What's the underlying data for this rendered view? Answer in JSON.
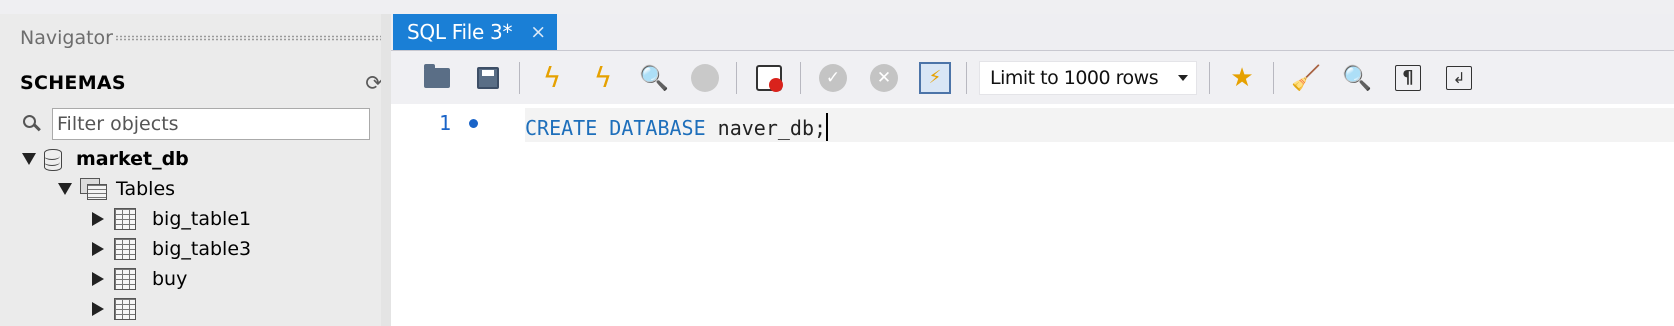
{
  "navigator": {
    "title": "Navigator",
    "schemas_label": "SCHEMAS",
    "filter_placeholder": "Filter objects",
    "tree": {
      "schema": "market_db",
      "folder": "Tables",
      "tables": [
        "big_table1",
        "big_table3",
        "buy"
      ]
    }
  },
  "editor": {
    "tab_label": "SQL File 3*",
    "tab_close": "×",
    "limit_label": "Limit to 1000 rows",
    "line_number": "1",
    "code": {
      "kw1": "CREATE",
      "kw2": "DATABASE",
      "ident": "naver_db;"
    }
  },
  "toolbar_icons": [
    "open-file-icon",
    "save-icon",
    "execute-icon",
    "execute-current-icon",
    "explain-icon",
    "stop-icon",
    "toggle-error-stop-icon",
    "commit-icon",
    "rollback-icon",
    "autocommit-icon",
    "beautify-icon",
    "find-icon",
    "invisible-chars-icon",
    "word-wrap-icon",
    "add-snippet-icon"
  ],
  "colors": {
    "tab_active": "#1a7fd6",
    "keyword": "#1e6fbb",
    "line_marker": "#1a64c8"
  }
}
